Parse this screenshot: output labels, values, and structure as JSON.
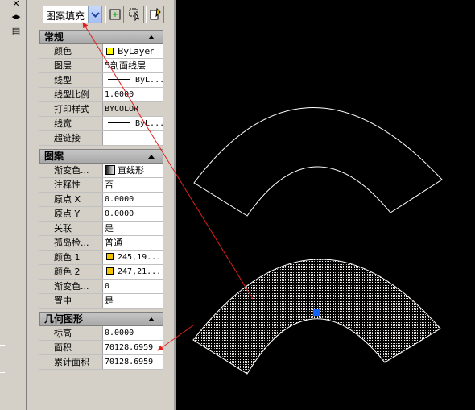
{
  "toolbar": {
    "object_type": "图案填充",
    "quick_select_icon": "quick-select-icon",
    "select_objects_icon": "select-objects-icon",
    "pickadd_icon": "pickadd-toggle-icon"
  },
  "sections": {
    "general": {
      "title": "常规",
      "rows": [
        {
          "label": "颜色",
          "value": "ByLayer",
          "swatch": "#ffff00"
        },
        {
          "label": "图层",
          "value": "5剖面线层"
        },
        {
          "label": "线型",
          "value": "ByL..."
        },
        {
          "label": "线型比例",
          "value": "1.0000"
        },
        {
          "label": "打印样式",
          "value": "BYCOLOR"
        },
        {
          "label": "线宽",
          "value": "ByL..."
        },
        {
          "label": "超链接",
          "value": ""
        }
      ]
    },
    "pattern": {
      "title": "图案",
      "rows": [
        {
          "label": "渐变色...",
          "value": "直线形"
        },
        {
          "label": "注释性",
          "value": "否"
        },
        {
          "label": "原点 X",
          "value": "0.0000"
        },
        {
          "label": "原点 Y",
          "value": "0.0000"
        },
        {
          "label": "关联",
          "value": "是"
        },
        {
          "label": "孤岛检...",
          "value": "普通"
        },
        {
          "label": "颜色 1",
          "value": "245,19...",
          "swatch": "#f0c000"
        },
        {
          "label": "颜色 2",
          "value": "247,21...",
          "swatch": "#f4c400"
        },
        {
          "label": "渐变色...",
          "value": "0"
        },
        {
          "label": "置中",
          "value": "是"
        }
      ]
    },
    "geometry": {
      "title": "几何图形",
      "rows": [
        {
          "label": "标高",
          "value": "0.0000"
        },
        {
          "label": "面积",
          "value": "70128.6959"
        },
        {
          "label": "累计面积",
          "value": "70128.6959"
        }
      ]
    }
  },
  "left_strip": {
    "close_icon": "close-icon",
    "autohide_icon": "autohide-icon",
    "properties_icon": "properties-icon"
  },
  "colors": {
    "annotation_arrow": "#e02020",
    "grip": "#1060ff",
    "outline": "#ffffff"
  }
}
